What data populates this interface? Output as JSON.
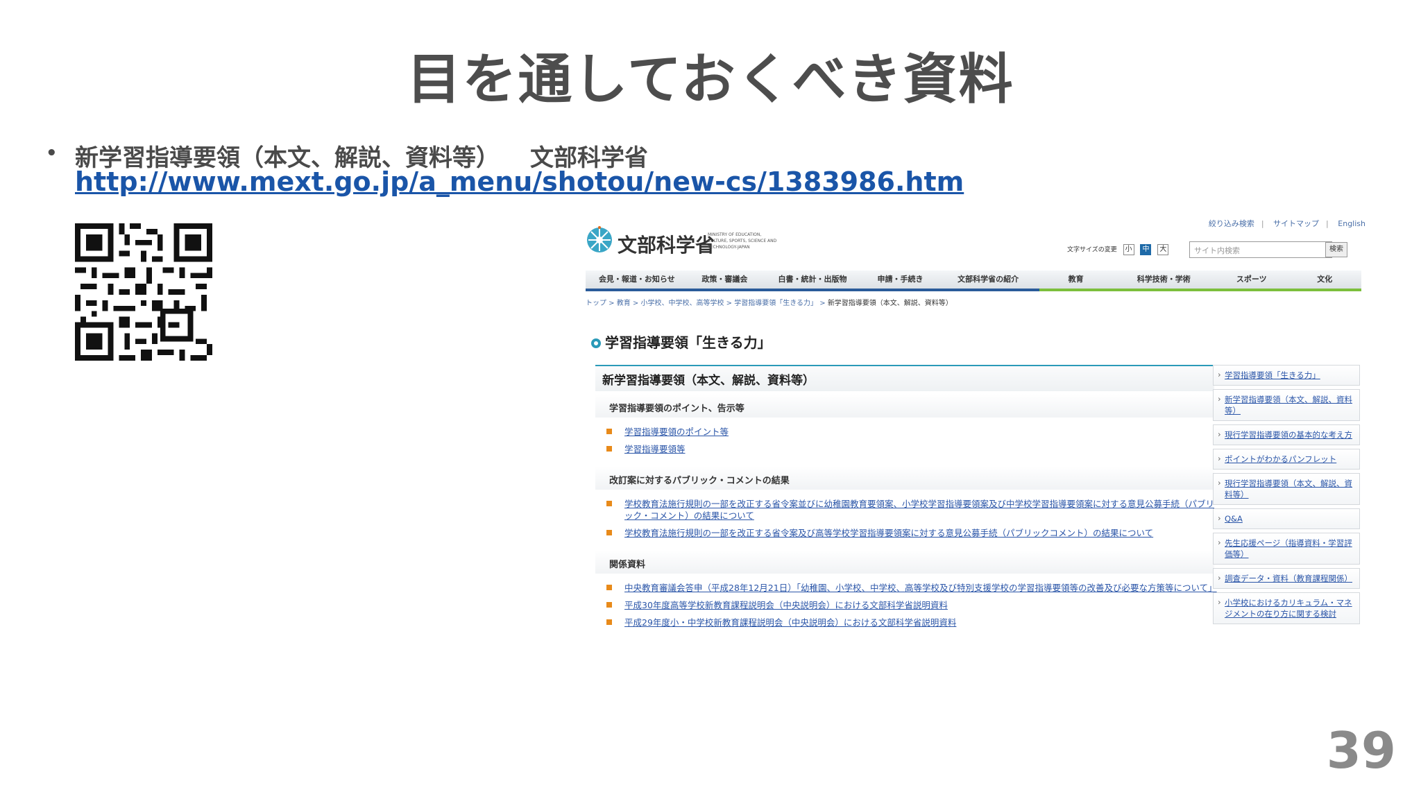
{
  "slide": {
    "title": "目を通しておくべき資料",
    "bullet": {
      "dot": "•",
      "text": "新学習指導要領（本文、解説、資料等）",
      "source": "文部科学省",
      "url": "http://www.mext.go.jp/a_menu/shotou/new-cs/1383986.htm"
    },
    "page_number": "39"
  },
  "site": {
    "util_links": [
      "絞り込み検索",
      "サイトマップ",
      "English"
    ],
    "logo_text": "文部科学省",
    "logo_en": "MINISTRY OF EDUCATION, CULTURE, SPORTS, SCIENCE AND TECHNOLOGY-JAPAN",
    "text_size_label": "文字サイズの変更",
    "text_sizes": [
      "小",
      "中",
      "大"
    ],
    "search_placeholder": "サイト内検索",
    "search_button": "検索",
    "nav": [
      "会見・報道・お知らせ",
      "政策・審議会",
      "白書・統計・出版物",
      "申請・手続き",
      "文部科学省の紹介",
      "教育",
      "科学技術・学術",
      "スポーツ",
      "文化"
    ],
    "breadcrumb": [
      "トップ",
      "教育",
      "小学校、中学校、高等学校",
      "学習指導要領「生きる力」"
    ],
    "breadcrumb_current": "新学習指導要領（本文、解説、資料等）",
    "page_heading": "学習指導要領「生きる力」",
    "main_title": "新学習指導要領（本文、解説、資料等）",
    "sections": [
      {
        "heading": "学習指導要領のポイント、告示等",
        "links": [
          "学習指導要領のポイント等",
          "学習指導要領等"
        ]
      },
      {
        "heading": "改訂案に対するパブリック・コメントの結果",
        "links": [
          "学校教育法施行規則の一部を改正する省令案並びに幼稚園教育要領案、小学校学習指導要領案及び中学校学習指導要領案に対する意見公募手続（パブリック・コメント）の結果について",
          "学校教育法施行規則の一部を改正する省令案及び高等学校学習指導要領案に対する意見公募手続（パブリックコメント）の結果について"
        ]
      },
      {
        "heading": "関係資料",
        "links": [
          "中央教育審議会答申（平成28年12月21日）「幼稚園、小学校、中学校、高等学校及び特別支援学校の学習指導要領等の改善及び必要な方策等について」",
          "平成30年度高等学校新教育課程説明会（中央説明会）における文部科学省説明資料",
          "平成29年度小・中学校新教育課程説明会（中央説明会）における文部科学省説明資料"
        ]
      }
    ],
    "sidebar": [
      "学習指導要領「生きる力」",
      "新学習指導要領（本文、解説、資料等）",
      "現行学習指導要領の基本的な考え方",
      "ポイントがわかるパンフレット",
      "現行学習指導要領（本文、解説、資料等）",
      "Q&A",
      "先生応援ページ（指導資料・学習評価等）",
      "調査データ・資料（教育課程関係）",
      "小学校におけるカリキュラム・マネジメントの在り方に関する検討"
    ]
  }
}
